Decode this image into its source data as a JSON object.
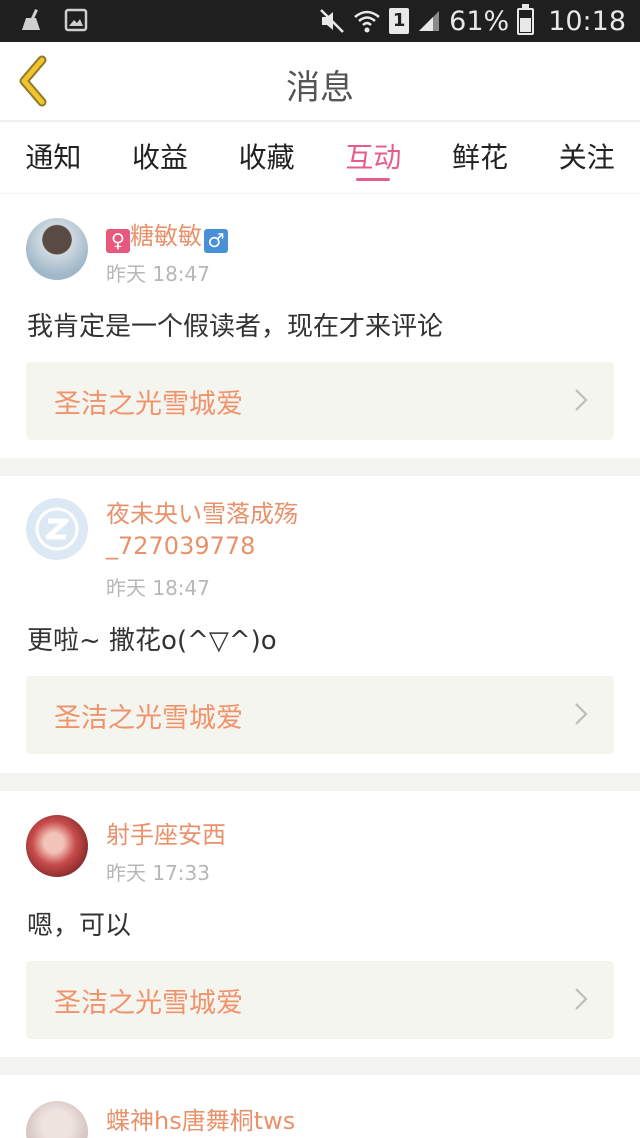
{
  "status_bar": {
    "battery": "61%",
    "time": "10:18",
    "sim_slot": "1",
    "icons": [
      "cleaner-icon",
      "image-icon",
      "mute-icon",
      "wifi-icon",
      "sim-icon",
      "signal-icon",
      "battery-icon"
    ]
  },
  "header": {
    "title": "消息",
    "back_icon": "chevron-left-icon",
    "accent": "#e85c8d",
    "back_color": "#f3c32d"
  },
  "tabs": [
    {
      "label": "通知",
      "active": false
    },
    {
      "label": "收益",
      "active": false
    },
    {
      "label": "收藏",
      "active": false
    },
    {
      "label": "互动",
      "active": true
    },
    {
      "label": "鲜花",
      "active": false
    },
    {
      "label": "关注",
      "active": false
    }
  ],
  "items": [
    {
      "user_prefix_icon": "female-symbol-icon",
      "user_suffix_icon": "male-symbol-icon",
      "female_symbol": "♀",
      "user": "糖敏敏",
      "male_symbol": "♂",
      "time": "昨天 18:47",
      "comment": "我肯定是一个假读者，现在才来评论",
      "book": "圣洁之光雪城爱"
    },
    {
      "user_line1": "夜未央い雪落成殇",
      "user_line2": "_727039778",
      "time": "昨天 18:47",
      "comment": "更啦~ 撒花o(^▽^)o",
      "book": "圣洁之光雪城爱"
    },
    {
      "user": "射手座安西",
      "time": "昨天 17:33",
      "comment": "嗯，可以",
      "book": "圣洁之光雪城爱"
    },
    {
      "user": "蝶神hs唐舞桐tws"
    }
  ],
  "colors": {
    "username": "#e9916a",
    "book_title": "#f0936c",
    "book_bg": "#f5f5ef",
    "divider": "#f3f3f1"
  }
}
